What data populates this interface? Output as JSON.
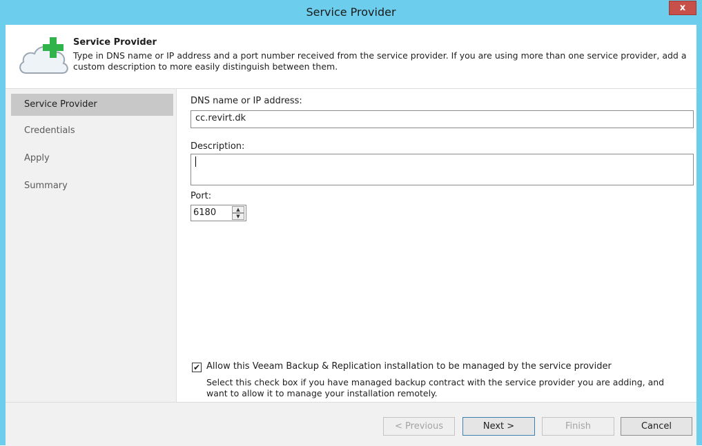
{
  "window": {
    "title": "Service Provider",
    "close_label": "x"
  },
  "header": {
    "title": "Service Provider",
    "description": "Type in DNS name or IP address and a port number received from the service provider. If you are using more than one service provider, add a custom description to more easily distinguish between them."
  },
  "nav": {
    "items": [
      {
        "label": "Service Provider",
        "active": true
      },
      {
        "label": "Credentials",
        "active": false
      },
      {
        "label": "Apply",
        "active": false
      },
      {
        "label": "Summary",
        "active": false
      }
    ]
  },
  "form": {
    "dns_label": "DNS name or IP address:",
    "dns_value": "cc.revirt.dk",
    "description_label": "Description:",
    "description_value": "",
    "port_label": "Port:",
    "port_value": "6180",
    "manage_checkbox_label": "Allow this Veeam Backup & Replication installation to be managed by the service provider",
    "manage_checkbox_checked": true,
    "manage_hint": "Select this check box if you have managed backup contract with the service provider you are adding, and want to allow it to manage your installation remotely.",
    "check_mark": "✔"
  },
  "footer": {
    "previous_label": "< Previous",
    "next_label": "Next >",
    "finish_label": "Finish",
    "cancel_label": "Cancel"
  },
  "colors": {
    "titlebar": "#6ccdec",
    "close_button": "#c7504a",
    "nav_active": "#c8c8c8",
    "icon_green": "#2fb34a"
  }
}
